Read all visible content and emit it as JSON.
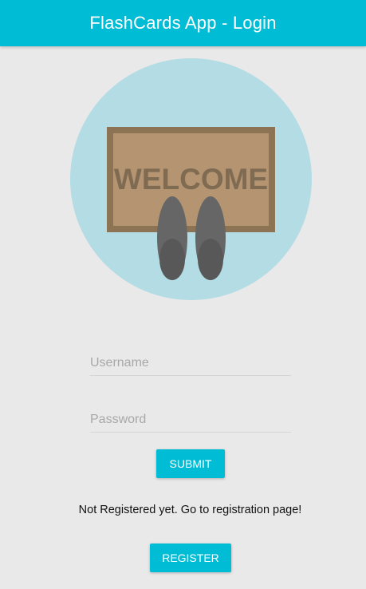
{
  "app_bar": {
    "title": "FlashCards App - Login",
    "color": "#00bcd4"
  },
  "hero": {
    "icon": "welcome-mat-icon",
    "mat_text": "WELCOME",
    "circle_color": "#b3dce4"
  },
  "form": {
    "username": {
      "placeholder": "Username",
      "value": ""
    },
    "password": {
      "placeholder": "Password",
      "value": ""
    },
    "submit_label": "SUBMIT"
  },
  "registration": {
    "prompt": "Not Registered yet. Go to registration page!",
    "register_label": "REGISTER"
  }
}
